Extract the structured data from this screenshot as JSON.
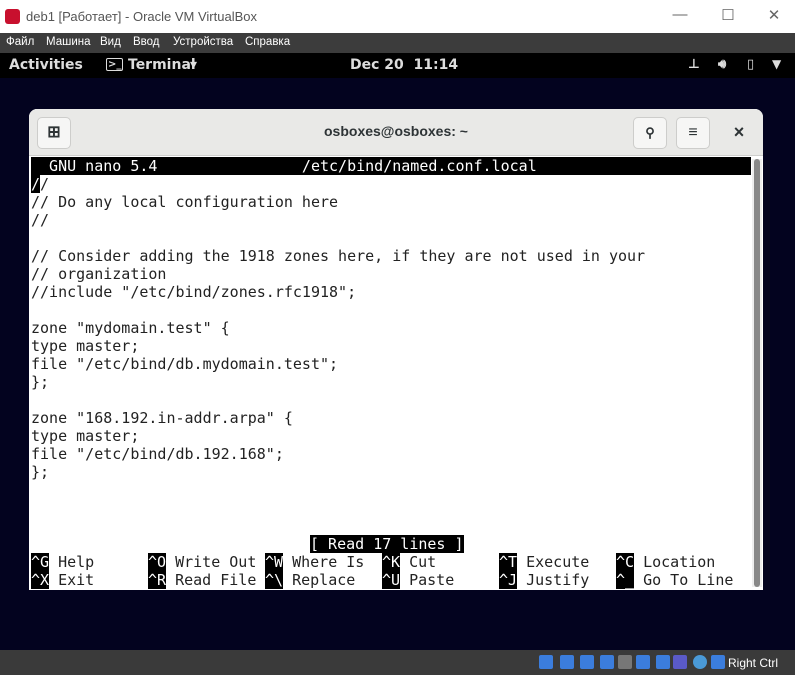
{
  "window": {
    "title": "deb1 [Работает] - Oracle VM VirtualBox",
    "minimize": "—",
    "maximize": "☐",
    "close": "✕"
  },
  "menu": [
    "Файл",
    "Машина",
    "Вид",
    "Ввод",
    "Устройства",
    "Справка"
  ],
  "topbar": {
    "activities": "Activities",
    "app": "Terminal",
    "app_icon": ">_",
    "dropdown": "▾",
    "clock": "Dec 20  11:14",
    "icons": [
      "network-icon",
      "volume-icon",
      "battery-icon",
      "system-menu-arrow-icon"
    ]
  },
  "terminal": {
    "title": "osboxes@osboxes: ~",
    "new_tab": "⊞",
    "search": "🔍",
    "menu": "≡",
    "close": "×"
  },
  "nano": {
    "header": "  GNU nano 5.4                /etc/bind/named.conf.local",
    "lines": [
      "//",
      "// Do any local configuration here",
      "//",
      "",
      "// Consider adding the 1918 zones here, if they are not used in your",
      "// organization",
      "//include \"/etc/bind/zones.rfc1918\";",
      "",
      "zone \"mydomain.test\" {",
      "type master;",
      "file \"/etc/bind/db.mydomain.test\";",
      "};",
      "",
      "zone \"168.192.in-addr.arpa\" {",
      "type master;",
      "file \"/etc/bind/db.192.168\";",
      "};"
    ],
    "status": "[ Read 17 lines ]",
    "shortcuts": [
      [
        {
          "key": "^G",
          "label": "Help"
        },
        {
          "key": "^O",
          "label": "Write Out"
        },
        {
          "key": "^W",
          "label": "Where Is"
        },
        {
          "key": "^K",
          "label": "Cut"
        },
        {
          "key": "^T",
          "label": "Execute"
        },
        {
          "key": "^C",
          "label": "Location"
        }
      ],
      [
        {
          "key": "^X",
          "label": "Exit"
        },
        {
          "key": "^R",
          "label": "Read File"
        },
        {
          "key": "^\\",
          "label": "Replace"
        },
        {
          "key": "^U",
          "label": "Paste"
        },
        {
          "key": "^J",
          "label": "Justify"
        },
        {
          "key": "^_",
          "label": "Go To Line"
        }
      ]
    ]
  },
  "vbox_status": {
    "host_key": "Right Ctrl"
  }
}
